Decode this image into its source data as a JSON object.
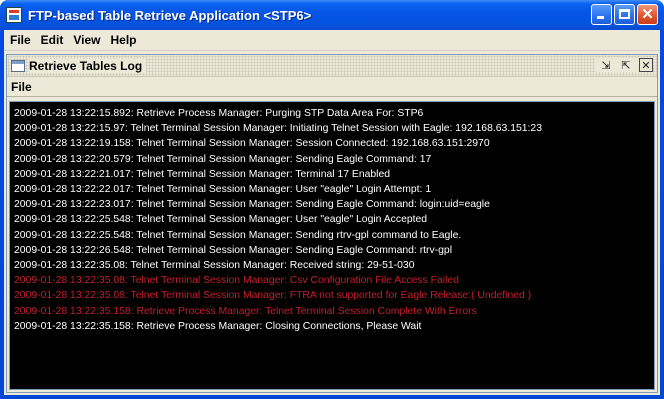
{
  "window": {
    "title": "FTP-based Table Retrieve Application <STP6>",
    "controls": {
      "minimize_icon": "minimize-icon",
      "maximize_icon": "maximize-icon",
      "close_icon": "close-icon"
    }
  },
  "menubar": {
    "items": [
      "File",
      "Edit",
      "View",
      "Help"
    ]
  },
  "inner_frame": {
    "title": "Retrieve Tables Log",
    "controls": [
      "restore-icon",
      "maximize-icon",
      "close-icon"
    ],
    "menubar": {
      "items": [
        "File"
      ]
    }
  },
  "log": {
    "colors": {
      "normal": "#ffffff",
      "error": "#c0202a",
      "background": "#000000"
    },
    "lines": [
      {
        "text": "2009-01-28 13:22:15.892: Retrieve Process Manager: Purging STP Data Area For: STP6",
        "level": "normal"
      },
      {
        "text": "2009-01-28 13:22:15.97: Telnet Terminal Session Manager: Initiating Telnet Session with Eagle: 192.168.63.151:23",
        "level": "normal"
      },
      {
        "text": "2009-01-28 13:22:19.158: Telnet Terminal Session Manager: Session Connected: 192.168.63.151:2970",
        "level": "normal"
      },
      {
        "text": "2009-01-28 13:22:20.579: Telnet Terminal Session Manager: Sending Eagle Command: 17",
        "level": "normal"
      },
      {
        "text": "2009-01-28 13:22:21.017: Telnet Terminal Session Manager: Terminal 17 Enabled",
        "level": "normal"
      },
      {
        "text": "2009-01-28 13:22:22.017: Telnet Terminal Session Manager: User \"eagle\" Login Attempt: 1",
        "level": "normal"
      },
      {
        "text": "2009-01-28 13:22:23.017: Telnet Terminal Session Manager: Sending Eagle Command: login:uid=eagle",
        "level": "normal"
      },
      {
        "text": "2009-01-28 13:22:25.548: Telnet Terminal Session Manager: User \"eagle\" Login Accepted",
        "level": "normal"
      },
      {
        "text": "2009-01-28 13:22:25.548: Telnet Terminal Session Manager: Sending rtrv-gpl command to Eagle.",
        "level": "normal"
      },
      {
        "text": "2009-01-28 13:22:26.548: Telnet Terminal Session Manager: Sending Eagle Command: rtrv-gpl",
        "level": "normal"
      },
      {
        "text": "2009-01-28 13:22:35.08: Telnet Terminal Session Manager: Received string: 29-51-030",
        "level": "normal"
      },
      {
        "text": "2009-01-28 13:22:35.08: Telnet Terminal Session Manager: Csv Configuration File Access Failed",
        "level": "error"
      },
      {
        "text": "2009-01-28 13:22:35.08: Telnet Terminal Session Manager: FTRA not supported for Eagle Release:( Undefined )",
        "level": "error"
      },
      {
        "text": "2009-01-28 13:22:35.158: Retrieve Process Manager: Telnet Terminal Session Complete With Errors",
        "level": "error"
      },
      {
        "text": "2009-01-28 13:22:35.158: Retrieve Process Manager: Closing Connections, Please Wait",
        "level": "normal"
      }
    ]
  }
}
